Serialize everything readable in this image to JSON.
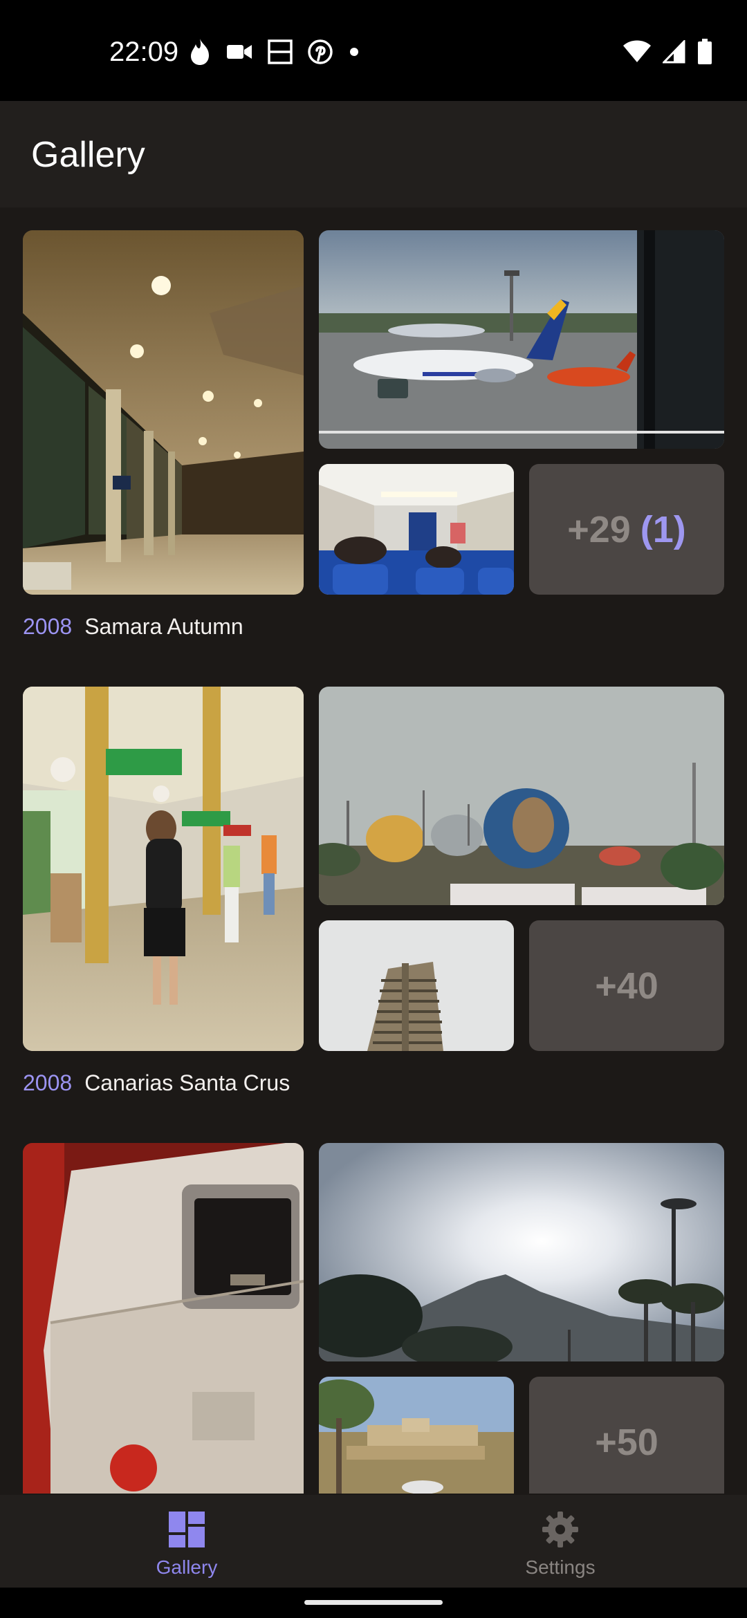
{
  "status_bar": {
    "time": "22:09",
    "left_icons": [
      "fire-icon",
      "video-camera-icon",
      "screen-split-icon",
      "pinterest-icon",
      "dot-icon"
    ],
    "right_icons": [
      "wifi-icon",
      "cell-signal-icon",
      "battery-icon"
    ]
  },
  "app_bar": {
    "title": "Gallery"
  },
  "albums": [
    {
      "year": "2008",
      "title": "Samara Autumn",
      "more": "+29",
      "selected": "(1)"
    },
    {
      "year": "2008",
      "title": "Canarias Santa Crus",
      "more": "+40"
    },
    {
      "year": "",
      "title": "",
      "more": "+50"
    }
  ],
  "bottom_nav": {
    "items": [
      {
        "label": "Gallery",
        "icon": "dashboard-icon",
        "active": true
      },
      {
        "label": "Settings",
        "icon": "gear-icon",
        "active": false
      }
    ]
  },
  "colors": {
    "accent": "#9c94f2",
    "background": "#1c1917",
    "surface": "#221f1d",
    "more_tile": "#4b4644"
  }
}
